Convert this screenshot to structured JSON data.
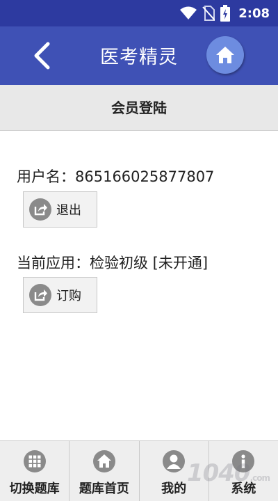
{
  "status_bar": {
    "time": "2:08"
  },
  "app_bar": {
    "title": "医考精灵"
  },
  "section": {
    "title": "会员登陆"
  },
  "user": {
    "label": "用户名：",
    "value": "865166025877807",
    "logout_label": "退出"
  },
  "application": {
    "label": "当前应用：",
    "value": "检验初级 [未开通]",
    "order_label": "订购"
  },
  "bottom_nav": {
    "items": [
      {
        "label": "切换题库",
        "icon": "grid-icon"
      },
      {
        "label": "题库首页",
        "icon": "home-icon"
      },
      {
        "label": "我的",
        "icon": "user-icon"
      },
      {
        "label": "系统",
        "icon": "info-icon"
      }
    ]
  },
  "watermark": {
    "text": "1040",
    "suffix": ".com"
  },
  "colors": {
    "status_bar": "#2d3aa0",
    "app_bar": "#3f51b5",
    "home_button": "#6d8ce0",
    "icon_gray": "#8a8a8a"
  }
}
